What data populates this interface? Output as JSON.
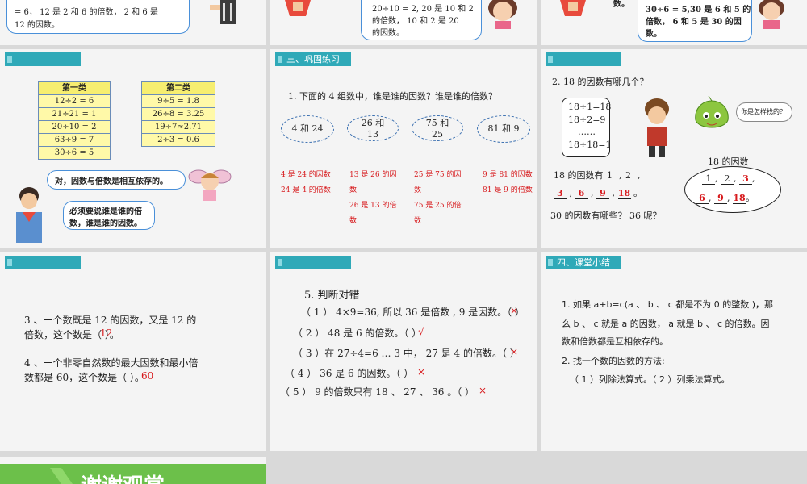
{
  "top_row": {
    "left_bubble_lines": [
      "= 6， 12 是 2 和 6 的倍数， 2 和 6 是",
      "12 的因数。"
    ],
    "mid_bubble_lines": [
      "20÷10 = 2, 20 是 10 和 2",
      "的倍数， 10 和 2 是 20",
      "的因数。"
    ],
    "right_fragment": "数。",
    "right_bubble_lines": [
      "30÷6 = 5,30 是 6 和 5 的",
      "倍数， 6 和 5 是 30 的因",
      "数。"
    ]
  },
  "p4": {
    "table1": {
      "header": "第一类",
      "rows": [
        "12÷2 = 6",
        "21÷21 = 1",
        "20÷10 = 2",
        "63÷9 = 7",
        "30÷6 = 5"
      ]
    },
    "table2": {
      "header": "第二类",
      "rows": [
        "9÷5 = 1.8",
        "26÷8 = 3.25",
        "19÷7≈2.71",
        "2÷3 = 0.6"
      ]
    },
    "bubble1": "对，因数与倍数是相互依存的。",
    "bubble2_lines": [
      "必须要说谁是谁的倍",
      "数，谁是谁的因数。"
    ]
  },
  "p5": {
    "tag": "三、巩固练习",
    "question": "1. 下面的 4 组数中，谁是谁的因数？谁是谁的倍数？",
    "pairs": [
      [
        "4 和 24"
      ],
      [
        "26 和",
        "13"
      ],
      [
        "75 和",
        "25"
      ],
      [
        "81 和 9"
      ]
    ],
    "answers": [
      [
        "4 是 24 的因数",
        "24 是 4 的倍数"
      ],
      [
        "13 是 26 的因",
        "数",
        "26 是 13 的倍",
        "数"
      ],
      [
        "25 是 75 的因",
        "数",
        "75 是 25 的倍",
        "数"
      ],
      [
        "9 是 81 的因数",
        "81 是 9 的倍数"
      ]
    ]
  },
  "p6": {
    "question": "2. 18 的因数有哪几个？",
    "box_lines": [
      "18÷1=18",
      "18÷2=9",
      "……",
      "18÷18=1"
    ],
    "leaf_bubble": "你是怎样找的？",
    "factors_prefix": "18 的因数有",
    "factors_line1": [
      "1",
      "2"
    ],
    "factors_line2": [
      "3",
      "6",
      "9",
      "18"
    ],
    "oval_title": "18 的因数",
    "oval_row1": [
      "1",
      "2",
      "3"
    ],
    "oval_row2": [
      "6",
      "9",
      "18"
    ],
    "question2": "30 的因数有哪些？ 36 呢？"
  },
  "p7": {
    "q3_lines": [
      "3 、一个数既是 12 的因数，又是 12 的",
      "倍数，这个数是（        ）。"
    ],
    "q3_answer": "12",
    "q4_lines": [
      "4 、一个非零自然数的最大因数和最小倍",
      "数都是   60，这个数是（        ）。"
    ],
    "q4_answer": "60"
  },
  "p8": {
    "title": "5. 判断对错",
    "items": [
      {
        "text": "（ 1 ） 4×9=36, 所以 36 是倍数 , 9 是因数。（    ）",
        "mark": "×"
      },
      {
        "text": "（ 2 ） 48 是 6 的倍数。（      ）",
        "mark": "√"
      },
      {
        "text": "（ 3 ）在 27÷4=6 … 3 中， 27 是 4 的倍数。（    ）",
        "mark": "×"
      },
      {
        "text": "（ 4 ） 36 是 6 的因数。（      ）",
        "mark": "×"
      },
      {
        "text": "（ 5 ） 9 的倍数只有 18 、 27 、 36 。（      ）",
        "mark": "×"
      }
    ]
  },
  "p9": {
    "tag": "四、课堂小结",
    "lines": [
      "1. 如果 a+b=c(a 、 b 、 c 都是不为 0 的整数 )，那",
      "么 b 、 c 就是 a 的因数， a 就是 b 、 c 的倍数。因",
      "数和倍数都是互相依存的。",
      "2. 找一个数的因数的方法:",
      "（ 1 ）列除法算式。（ 2 ）列乘法算式。"
    ]
  },
  "thanks": "谢谢观赏",
  "colors": {
    "accent": "#2fa9b8",
    "answer_red": "#d7191c",
    "green": "#6cc04a"
  }
}
